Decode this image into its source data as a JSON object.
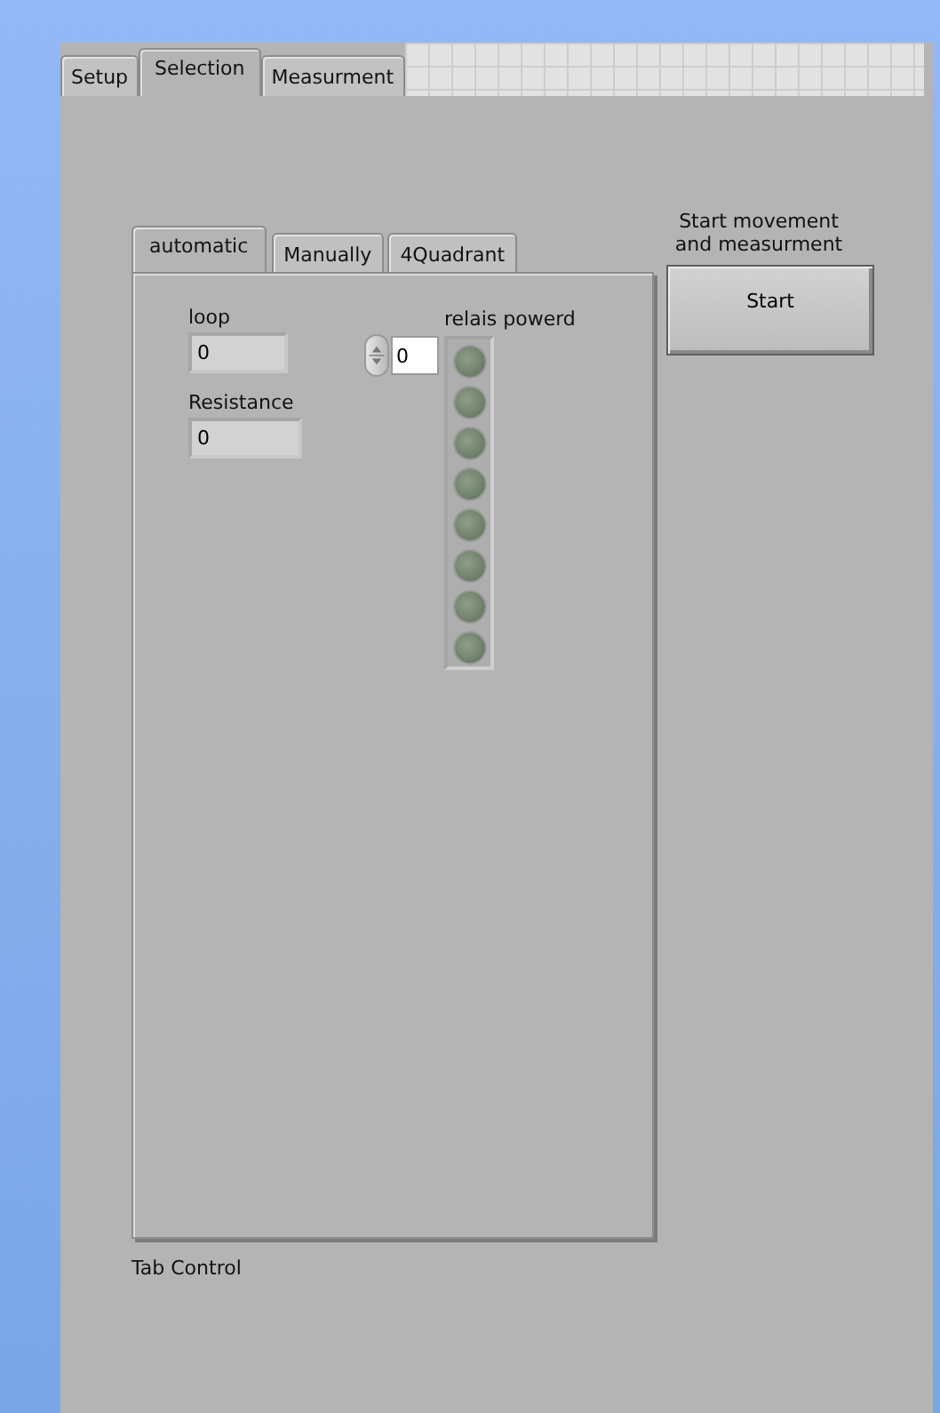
{
  "outer_tabs": [
    {
      "label": "Setup",
      "selected": false
    },
    {
      "label": "Selection",
      "selected": true
    },
    {
      "label": "Measurment",
      "selected": false
    }
  ],
  "inner_tabs": [
    {
      "label": "automatic",
      "selected": true
    },
    {
      "label": "Manually",
      "selected": false
    },
    {
      "label": "4Quadrant",
      "selected": false
    }
  ],
  "loop": {
    "label": "loop",
    "value": "0"
  },
  "resistance": {
    "label": "Resistance",
    "value": "0"
  },
  "relais": {
    "label": "relais powerd",
    "index": "0",
    "leds": [
      {
        "on": false
      },
      {
        "on": false
      },
      {
        "on": false
      },
      {
        "on": false
      },
      {
        "on": false
      },
      {
        "on": false
      },
      {
        "on": false
      },
      {
        "on": false
      }
    ]
  },
  "tab_control_label": "Tab Control",
  "start": {
    "label_lines": [
      "Start movement",
      "and measurment"
    ],
    "button": "Start"
  }
}
